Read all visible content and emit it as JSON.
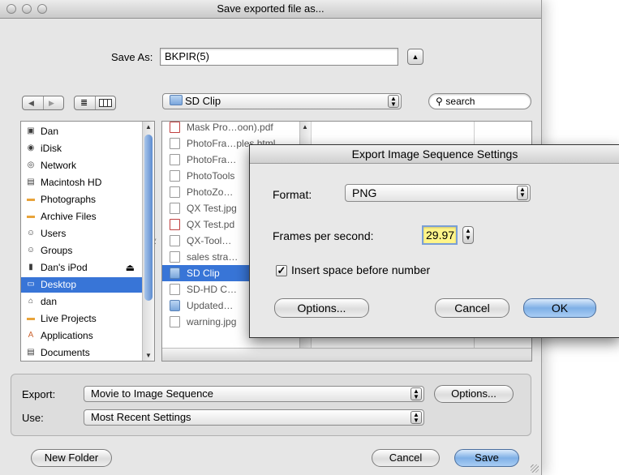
{
  "window": {
    "title": "Save exported file as..."
  },
  "save_as": {
    "label": "Save As:",
    "value": "BKPIR(5)"
  },
  "toolbar": {
    "back_icon": "back-arrow-icon",
    "forward_icon": "forward-arrow-icon",
    "location": "SD Clip",
    "search_placeholder": "search"
  },
  "sidebar": {
    "items": [
      {
        "label": "Dan",
        "icon": "computer-icon"
      },
      {
        "label": "iDisk",
        "icon": "idisk-icon"
      },
      {
        "label": "Network",
        "icon": "network-icon"
      },
      {
        "label": "Macintosh HD",
        "icon": "harddisk-icon"
      },
      {
        "label": "Photographs",
        "icon": "folder-icon"
      },
      {
        "label": "Archive Files",
        "icon": "folder-icon"
      },
      {
        "label": "Users",
        "icon": "users-icon"
      },
      {
        "label": "Groups",
        "icon": "groups-icon"
      },
      {
        "label": "Dan's iPod",
        "icon": "ipod-icon",
        "eject": "⏏"
      },
      {
        "label": "Desktop",
        "icon": "desktop-icon",
        "selected": true
      },
      {
        "label": "dan",
        "icon": "home-icon"
      },
      {
        "label": "Live Projects",
        "icon": "folder-icon"
      },
      {
        "label": "Applications",
        "icon": "applications-icon"
      },
      {
        "label": "Documents",
        "icon": "documents-icon"
      }
    ]
  },
  "files": {
    "items": [
      {
        "label": "Mask Pro…oon).pdf",
        "type": "pdf"
      },
      {
        "label": "PhotoFra…ples.html",
        "type": "doc"
      },
      {
        "label": "PhotoFra…",
        "type": "doc"
      },
      {
        "label": "PhotoTools",
        "type": "doc"
      },
      {
        "label": "PhotoZo…",
        "type": "doc"
      },
      {
        "label": "QX Test.jpg",
        "type": "doc"
      },
      {
        "label": "QX Test.pd",
        "type": "pdf"
      },
      {
        "label": "QX-Tool…",
        "type": "doc"
      },
      {
        "label": "sales stra…",
        "type": "doc"
      },
      {
        "label": "SD Clip",
        "type": "folder",
        "selected": true
      },
      {
        "label": "SD-HD C…",
        "type": "doc"
      },
      {
        "label": "Updated…",
        "type": "folder"
      },
      {
        "label": "warning.jpg",
        "type": "doc"
      }
    ]
  },
  "export": {
    "export_label": "Export:",
    "export_value": "Movie to Image Sequence",
    "options_label": "Options...",
    "use_label": "Use:",
    "use_value": "Most Recent Settings"
  },
  "buttons": {
    "new_folder": "New Folder",
    "cancel": "Cancel",
    "save": "Save"
  },
  "sheet": {
    "title": "Export Image Sequence Settings",
    "format_label": "Format:",
    "format_value": "PNG",
    "fps_label": "Frames per second:",
    "fps_value": "29.97",
    "checkbox_label": "Insert space before number",
    "checkbox_checked": true,
    "options_label": "Options...",
    "cancel_label": "Cancel",
    "ok_label": "OK"
  }
}
